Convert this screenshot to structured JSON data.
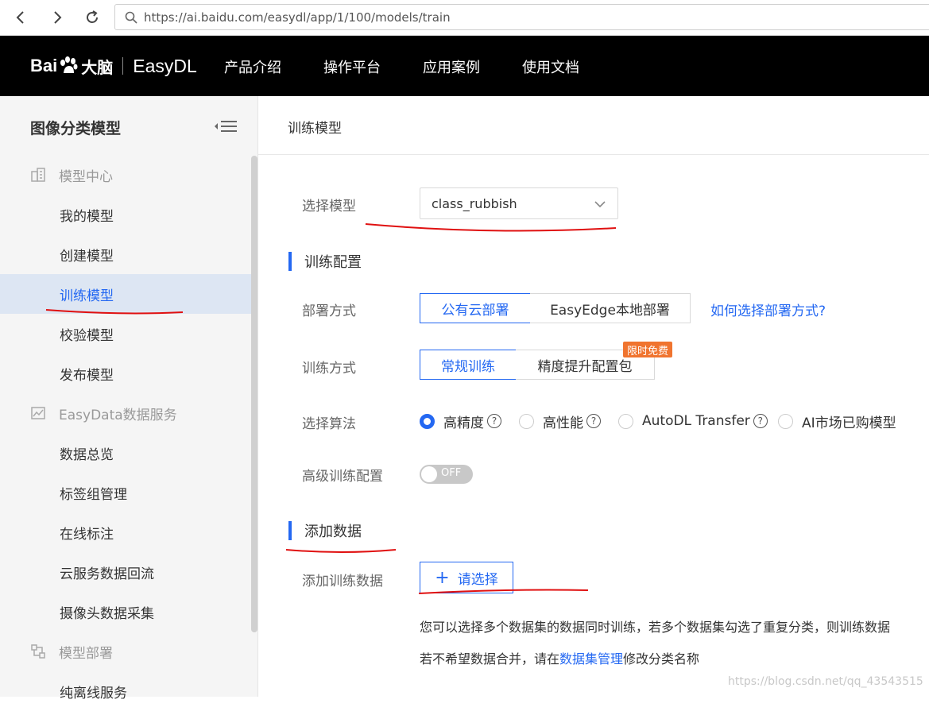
{
  "browser": {
    "url": "https://ai.baidu.com/easydl/app/1/100/models/train"
  },
  "brand": {
    "bai": "Bai",
    "dn": "大脑",
    "product": "EasyDL"
  },
  "topnav": [
    "产品介绍",
    "操作平台",
    "应用案例",
    "使用文档"
  ],
  "sidebar": {
    "title": "图像分类模型",
    "groups": [
      {
        "label": "模型中心",
        "icon": "building-icon",
        "items": [
          "我的模型",
          "创建模型",
          "训练模型",
          "校验模型",
          "发布模型"
        ]
      },
      {
        "label": "EasyData数据服务",
        "icon": "chart-icon",
        "items": [
          "数据总览",
          "标签组管理",
          "在线标注",
          "云服务数据回流",
          "摄像头数据采集"
        ]
      },
      {
        "label": "模型部署",
        "icon": "deploy-icon",
        "items": [
          "纯离线服务"
        ]
      }
    ],
    "active": "训练模型"
  },
  "main": {
    "header": "训练模型",
    "select_model": {
      "label": "选择模型",
      "value": "class_rubbish"
    },
    "section_train": "训练配置",
    "deploy": {
      "label": "部署方式",
      "options": [
        "公有云部署",
        "EasyEdge本地部署"
      ],
      "selected": "公有云部署",
      "help_link": "如何选择部署方式?"
    },
    "train_mode": {
      "label": "训练方式",
      "options": [
        "常规训练",
        "精度提升配置包"
      ],
      "selected": "常规训练",
      "badge": "限时免费"
    },
    "algorithm": {
      "label": "选择算法",
      "options": [
        "高精度",
        "高性能",
        "AutoDL Transfer",
        "AI市场已购模型"
      ],
      "selected": "高精度",
      "help": "?"
    },
    "advanced": {
      "label": "高级训练配置",
      "toggle": "OFF"
    },
    "section_data": "添加数据",
    "add_data": {
      "label": "添加训练数据",
      "button": "请选择"
    },
    "desc1": "您可以选择多个数据集的数据同时训练，若多个数据集勾选了重复分类，则训练数据",
    "desc2_pre": "若不希望数据合并，请在",
    "desc2_link": "数据集管理",
    "desc2_post": "修改分类名称"
  },
  "watermark": "https://blog.csdn.net/qq_43543515",
  "colors": {
    "accent": "#2468f2",
    "badge": "#f0742f",
    "annotation": "#e01010"
  }
}
